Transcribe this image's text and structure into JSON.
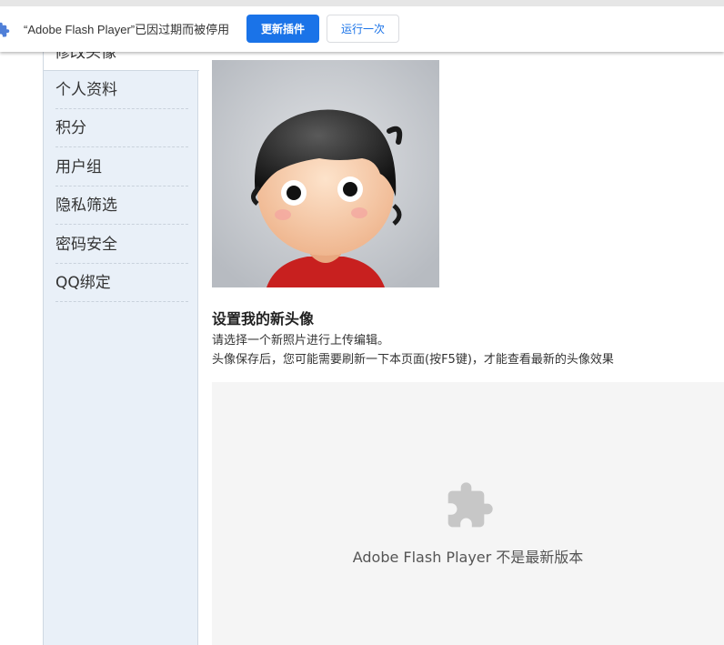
{
  "infobar": {
    "message": "“Adobe Flash Player”已因过期而被停用",
    "update_button": "更新插件",
    "run_once_button": "运行一次",
    "icon": "puzzle-icon",
    "accent_color": "#1a73e8"
  },
  "sidebar": {
    "active_item": "修改头像",
    "items": [
      {
        "label": "个人资料"
      },
      {
        "label": "积分"
      },
      {
        "label": "用户组"
      },
      {
        "label": "隐私筛选"
      },
      {
        "label": "密码安全"
      },
      {
        "label": "QQ绑定"
      }
    ]
  },
  "main": {
    "title": "设置我的新头像",
    "description_line1": "请选择一个新照片进行上传编辑。",
    "description_line2": "头像保存后，您可能需要刷新一下本页面(按F5键)，才能查看最新的头像效果",
    "plugin_placeholder": {
      "icon": "puzzle-icon",
      "message": "Adobe Flash Player 不是最新版本"
    }
  }
}
